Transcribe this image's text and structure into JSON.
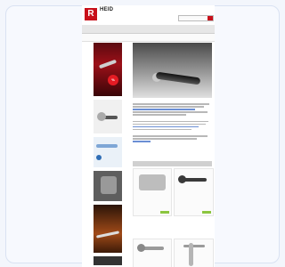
{
  "site": {
    "logo_mark": "R",
    "logo_text": "HEID",
    "logo_sub": "",
    "top_links": "",
    "search_placeholder": ""
  },
  "nav": {
    "items": [
      "",
      "",
      "",
      "",
      "",
      "",
      ""
    ]
  },
  "subnav": {
    "items": [
      "",
      ""
    ]
  },
  "left_blocks": [
    {
      "title": "",
      "text": "",
      "sale": "%"
    },
    {
      "title": "",
      "text": ""
    },
    {
      "title": "",
      "text": ""
    },
    {
      "title": "",
      "text": ""
    },
    {
      "title": "",
      "text": ""
    },
    {
      "title": "",
      "text": ""
    }
  ],
  "hero": {
    "title": "",
    "subtitle": ""
  },
  "article": {
    "title": ""
  },
  "products_section": {
    "title": ""
  },
  "products": [
    {
      "name": "",
      "price": ""
    },
    {
      "name": "",
      "price": ""
    },
    {
      "name": "",
      "price": ""
    },
    {
      "name": "",
      "price": ""
    }
  ],
  "colors": {
    "brand_red": "#c8101a",
    "sale_red": "#e41b23",
    "cart_green": "#8cc63f",
    "link_blue": "#6b8fd4",
    "card_border": "#d9e2f2",
    "background": "#f3f6fc"
  }
}
